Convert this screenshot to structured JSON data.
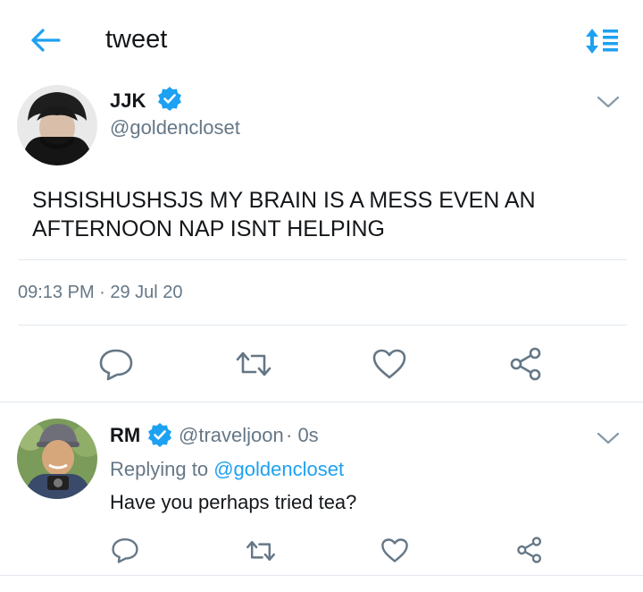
{
  "header": {
    "title": "tweet",
    "back_icon": "arrow-left-icon",
    "sort_icon": "sort-list-icon",
    "accent": "#1da1f2"
  },
  "main_tweet": {
    "name": "JJK",
    "handle": "@goldencloset",
    "text": "SHSISHUSHSJS MY BRAIN IS A MESS EVEN AN AFTERNOON NAP ISNT HELPING",
    "timestamp": "09:13 PM · 29 Jul 20",
    "actions": [
      "reply-icon",
      "retweet-icon",
      "like-icon",
      "share-icon"
    ]
  },
  "reply": {
    "name": "RM",
    "handle": "@traveljoon",
    "time": "· 0s",
    "replying_prefix": "Replying to",
    "replying_to": "@goldencloset",
    "text": "Have you perhaps tried tea?",
    "actions": [
      "reply-icon",
      "retweet-icon",
      "like-icon",
      "share-icon"
    ]
  },
  "colors": {
    "text": "#14171a",
    "secondary": "#657786",
    "accent": "#1da1f2",
    "divider": "#e1e8ed"
  }
}
